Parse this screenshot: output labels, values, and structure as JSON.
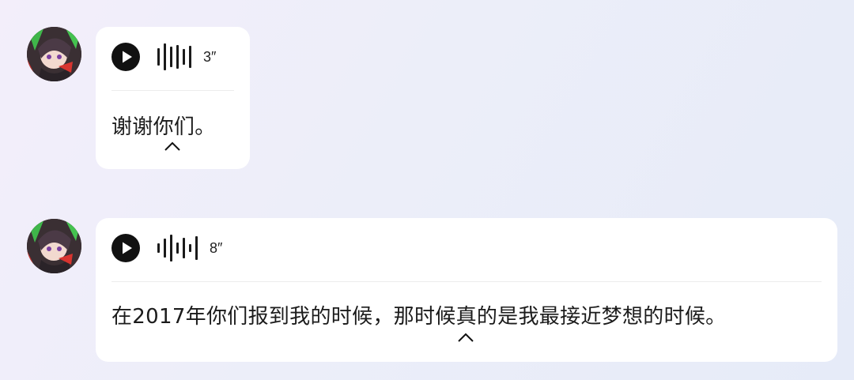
{
  "messages": [
    {
      "duration": "3″",
      "transcript": "谢谢你们。",
      "collapse_icon": "chevron-up-icon",
      "play_icon": "play-icon"
    },
    {
      "duration": "8″",
      "transcript": "在2017年你们报到我的时候，那时候真的是我最接近梦想的时候。",
      "collapse_icon": "chevron-up-icon",
      "play_icon": "play-icon"
    }
  ],
  "colors": {
    "bubble": "#ffffff",
    "text": "#1b1b1b",
    "icon": "#111111"
  }
}
